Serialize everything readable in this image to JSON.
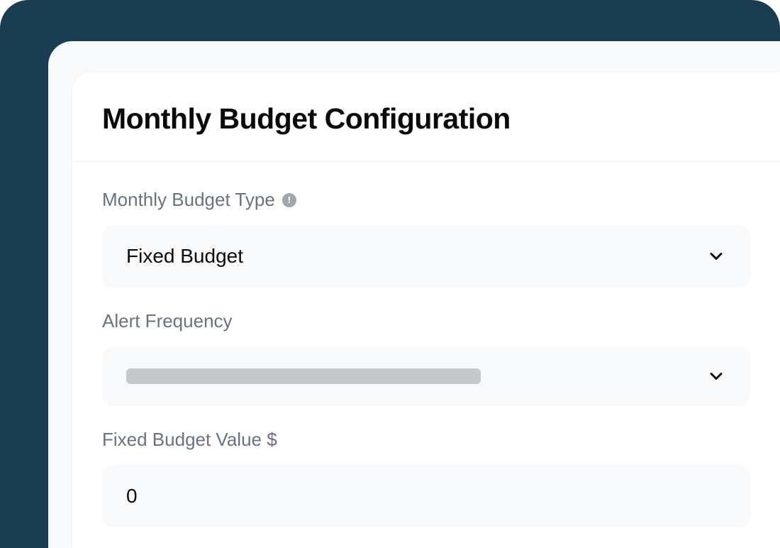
{
  "card": {
    "title": "Monthly Budget Configuration"
  },
  "fields": {
    "budget_type": {
      "label": "Monthly Budget Type",
      "value": "Fixed Budget"
    },
    "alert_frequency": {
      "label": "Alert Frequency"
    },
    "fixed_budget_value": {
      "label": "Fixed Budget Value $",
      "value": "0"
    }
  }
}
